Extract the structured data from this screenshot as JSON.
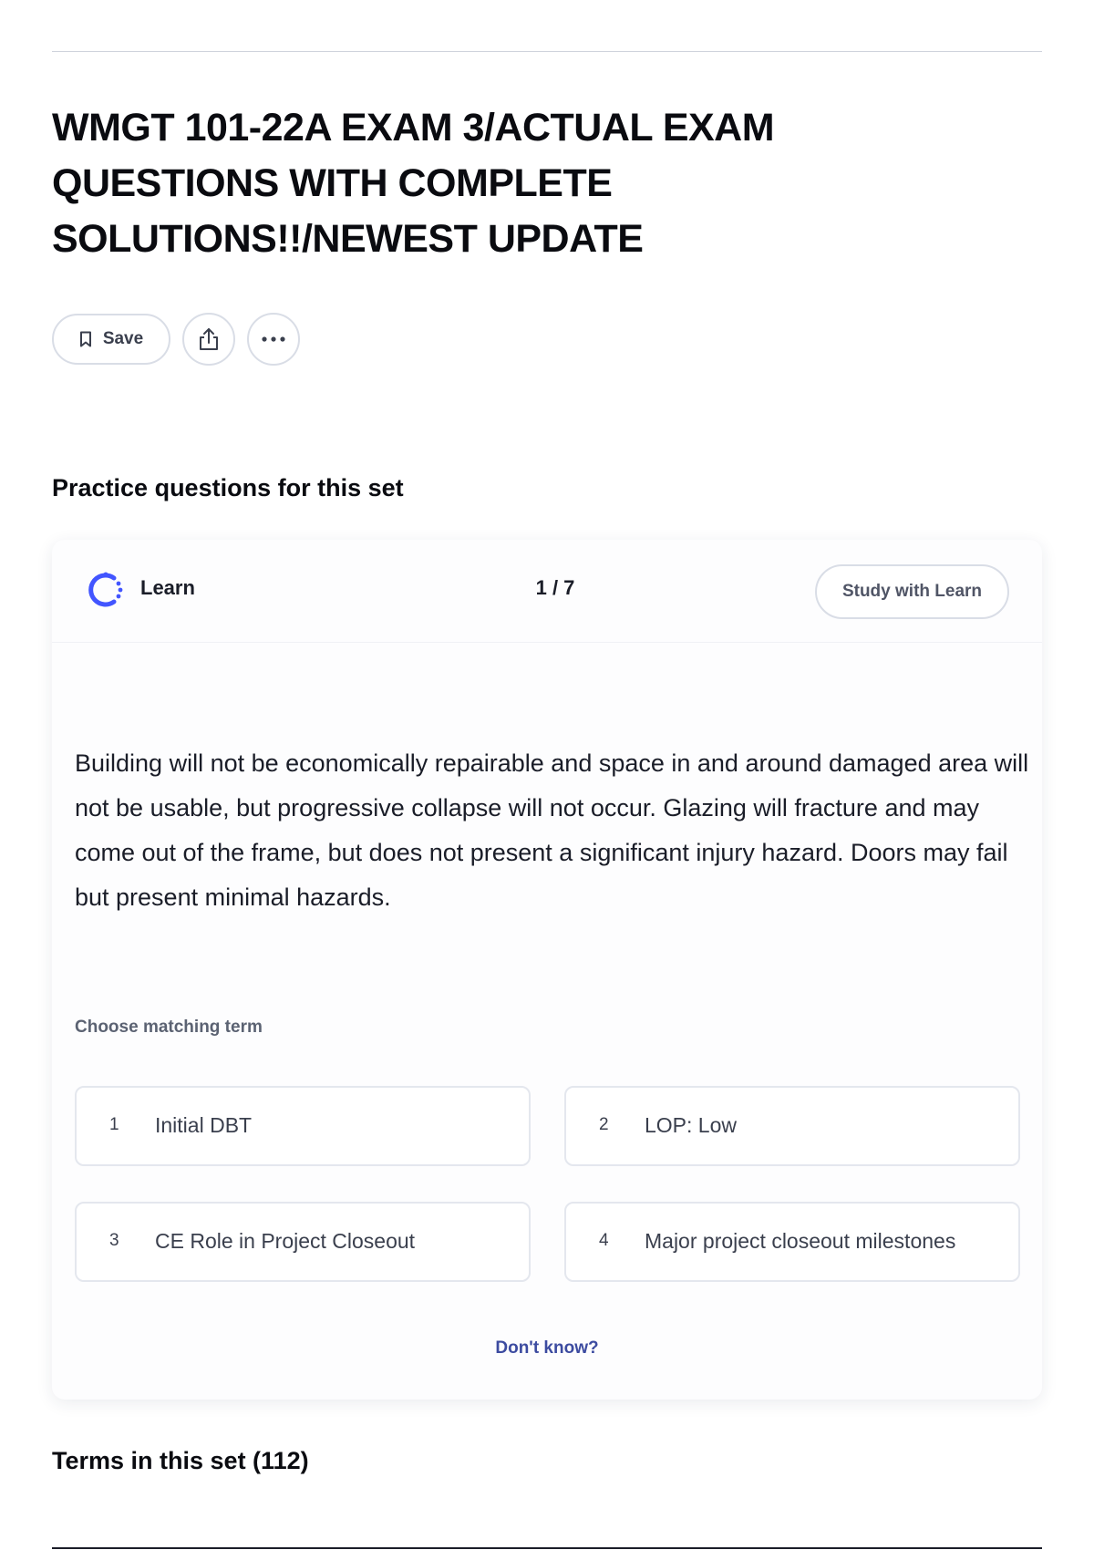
{
  "title": "WMGT 101-22A EXAM 3/ACTUAL EXAM QUESTIONS WITH COMPLETE SOLUTIONS!!/NEWEST UPDATE",
  "actions": {
    "save_label": "Save",
    "save_icon": "bookmark-icon",
    "share_icon": "share-icon",
    "more_icon": "more-horizontal-icon"
  },
  "practice": {
    "heading": "Practice questions for this set",
    "mode_label": "Learn",
    "mode_icon": "learn-progress-icon",
    "progress": "1 / 7",
    "study_button": "Study with Learn",
    "definition": "Building will not be economically repairable and space in and around damaged area will not be usable, but progressive collapse will not occur. Glazing will fracture and may come out of the frame, but does not present a significant injury hazard. Doors may fail but present minimal hazards.",
    "prompt": "Choose matching term",
    "options": [
      {
        "number": "1",
        "text": "Initial DBT"
      },
      {
        "number": "2",
        "text": "LOP: Low"
      },
      {
        "number": "3",
        "text": "CE Role in Project Closeout"
      },
      {
        "number": "4",
        "text": "Major project closeout milestones"
      }
    ],
    "dont_know": "Don't know?"
  },
  "terms_heading": "Terms in this set (112)",
  "colors": {
    "accent": "#4255ff",
    "link": "#3c4ba0",
    "border": "#d9dde6"
  }
}
